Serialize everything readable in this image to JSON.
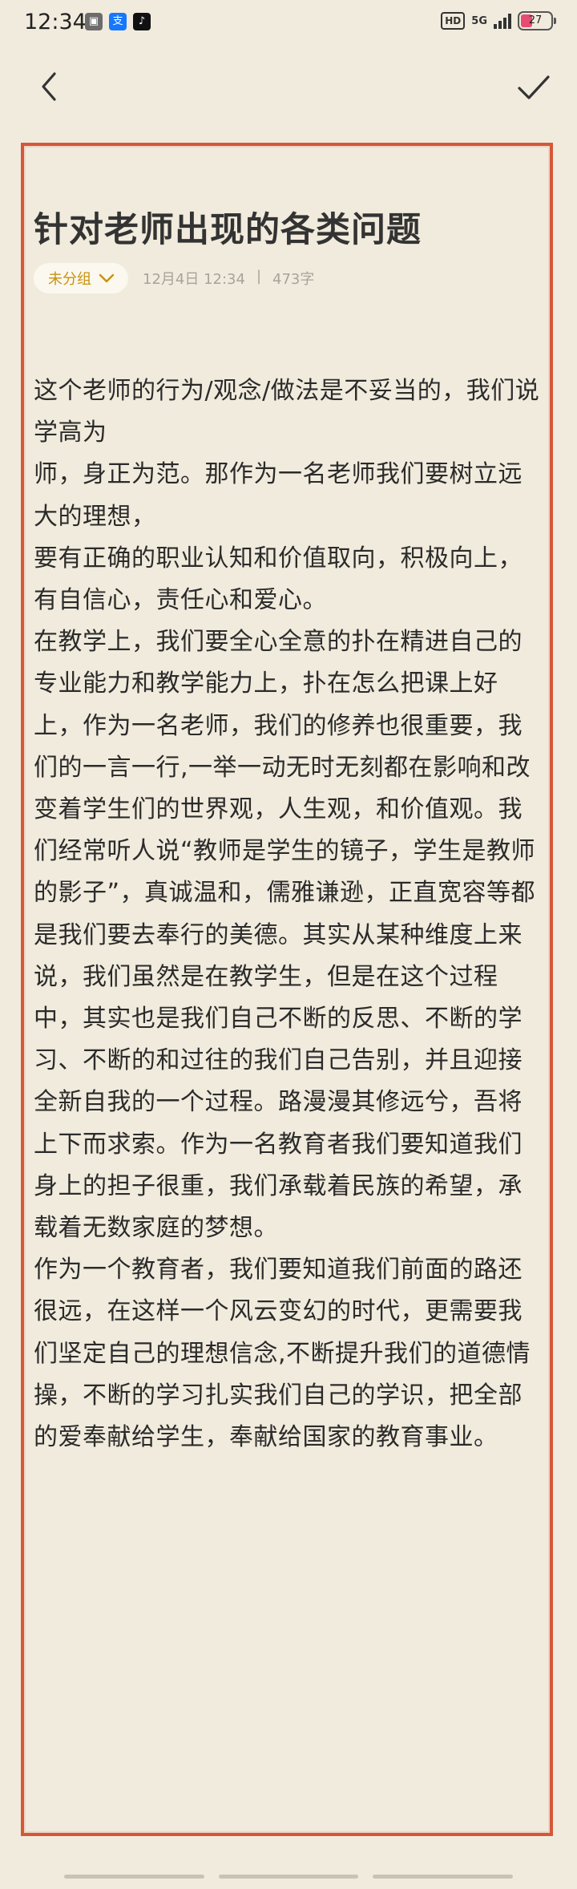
{
  "status_bar": {
    "time": "12:34",
    "network": "5G",
    "battery_level": "27",
    "hd_label": "HD",
    "app_icons": [
      "gallery-icon",
      "alipay-icon",
      "tiktok-icon"
    ]
  },
  "nav": {
    "back_icon": "chevron-left-icon",
    "confirm_icon": "checkmark-icon"
  },
  "note": {
    "title": "针对老师出现的各类问题",
    "category": "未分组",
    "date": "12月4日 12:34",
    "separator": "|",
    "word_count": "473字",
    "paragraphs": [
      "这个老师的行为/观念/做法是不妥当的，我们说学高为",
      "师，身正为范。那作为一名老师我们要树立远大的理想，",
      "要有正确的职业认知和价值取向，积极向上，有自信心，责任心和爱心。",
      "在教学上，我们要全心全意的扑在精进自己的专业能力和教学能力上，扑在怎么把课上好上，作为一名老师，我们的修养也很重要，我们的一言一行,一举一动无时无刻都在影响和改变着学生们的世界观，人生观，和价值观。我们经常听人说“教师是学生的镜子，学生是教师的影子”，真诚温和，儒雅谦逊，正直宽容等都是我们要去奉行的美德。其实从某种维度上来说，我们虽然是在教学生，但是在这个过程中，其实也是我们自己不断的反思、不断的学习、不断的和过往的我们自己告别，并且迎接全新自我的一个过程。路漫漫其修远兮，吾将上下而求索。作为一名教育者我们要知道我们身上的担子很重，我们承载着民族的希望，承载着无数家庭的梦想。",
      "作为一个教育者，我们要知道我们前面的路还很远，在这样一个风云变幻的时代，更需要我们坚定自己的理想信念,不断提升我们的道德情操，不断的学习扎实我们自己的学识，把全部的爱奉献给学生，奉献给国家的教育事业。"
    ]
  },
  "colors": {
    "background": "#f1ebdd",
    "frame": "#d4573a",
    "category_text": "#c9920e",
    "battery_fill": "#e84b72"
  }
}
